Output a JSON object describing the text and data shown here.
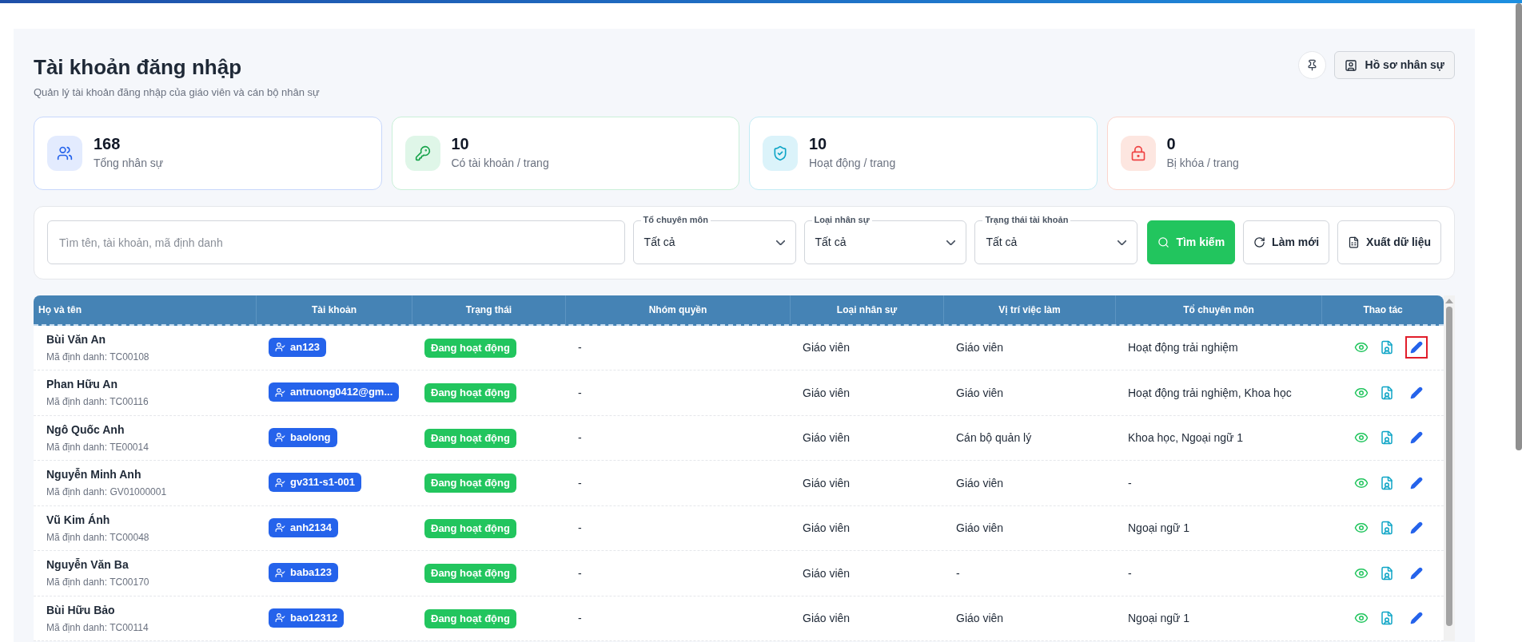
{
  "header": {
    "title": "Tài khoản đăng nhập",
    "subtitle": "Quản lý tài khoản đăng nhập của giáo viên và cán bộ nhân sự",
    "profile_button": "Hồ sơ nhân sự"
  },
  "stats": [
    {
      "kind": "staff",
      "value": "168",
      "label": "Tổng nhân sự"
    },
    {
      "kind": "account",
      "value": "10",
      "label": "Có tài khoản / trang"
    },
    {
      "kind": "active",
      "value": "10",
      "label": "Hoạt động / trang"
    },
    {
      "kind": "locked",
      "value": "0",
      "label": "Bị khóa / trang"
    }
  ],
  "filters": {
    "search": {
      "placeholder": "Tìm tên, tài khoản, mã định danh"
    },
    "selects": [
      {
        "label": "Tổ chuyên môn",
        "value": "Tất cả"
      },
      {
        "label": "Loại nhân sự",
        "value": "Tất cả"
      },
      {
        "label": "Trạng thái tài khoản",
        "value": "Tất cả"
      }
    ],
    "buttons": [
      {
        "kind": "search",
        "label": "Tìm kiếm"
      },
      {
        "kind": "refresh",
        "label": "Làm mới"
      },
      {
        "kind": "export",
        "label": "Xuất dữ liệu"
      }
    ]
  },
  "table": {
    "columns": [
      "Họ và tên",
      "Tài khoản",
      "Trạng thái",
      "Nhóm quyền",
      "Loại nhân sự",
      "Vị trí việc làm",
      "Tổ chuyên môn",
      "Thao tác"
    ],
    "rows": [
      {
        "name": "Bùi Văn An",
        "id": "Mã định danh: TC00108",
        "account": "an123",
        "status": "Đang hoạt động",
        "group": "-",
        "type": "Giáo viên",
        "position": "Giáo viên",
        "department": "Hoạt động trải nghiệm",
        "edit_highlighted": true
      },
      {
        "name": "Phan Hữu An",
        "id": "Mã định danh: TC00116",
        "account": "antruong0412@gm...",
        "status": "Đang hoạt động",
        "group": "-",
        "type": "Giáo viên",
        "position": "Giáo viên",
        "department": "Hoạt động trải nghiệm, Khoa học",
        "edit_highlighted": false
      },
      {
        "name": "Ngô Quốc Anh",
        "id": "Mã định danh: TE00014",
        "account": "baolong",
        "status": "Đang hoạt động",
        "group": "-",
        "type": "Giáo viên",
        "position": "Cán bộ quản lý",
        "department": "Khoa học, Ngoại ngữ 1",
        "edit_highlighted": false
      },
      {
        "name": "Nguyễn Minh Anh",
        "id": "Mã định danh: GV01000001",
        "account": "gv311-s1-001",
        "status": "Đang hoạt động",
        "group": "-",
        "type": "Giáo viên",
        "position": "Giáo viên",
        "department": "-",
        "edit_highlighted": false
      },
      {
        "name": "Vũ Kim Ánh",
        "id": "Mã định danh: TC00048",
        "account": "anh2134",
        "status": "Đang hoạt động",
        "group": "-",
        "type": "Giáo viên",
        "position": "Giáo viên",
        "department": "Ngoại ngữ 1",
        "edit_highlighted": false
      },
      {
        "name": "Nguyễn Văn Ba",
        "id": "Mã định danh: TC00170",
        "account": "baba123",
        "status": "Đang hoạt động",
        "group": "-",
        "type": "Giáo viên",
        "position": "-",
        "department": "-",
        "edit_highlighted": false
      },
      {
        "name": "Bùi Hữu Bảo",
        "id": "Mã định danh: TC00114",
        "account": "bao12312",
        "status": "Đang hoạt động",
        "group": "-",
        "type": "Giáo viên",
        "position": "Giáo viên",
        "department": "Ngoại ngữ 1",
        "edit_highlighted": false
      }
    ]
  }
}
